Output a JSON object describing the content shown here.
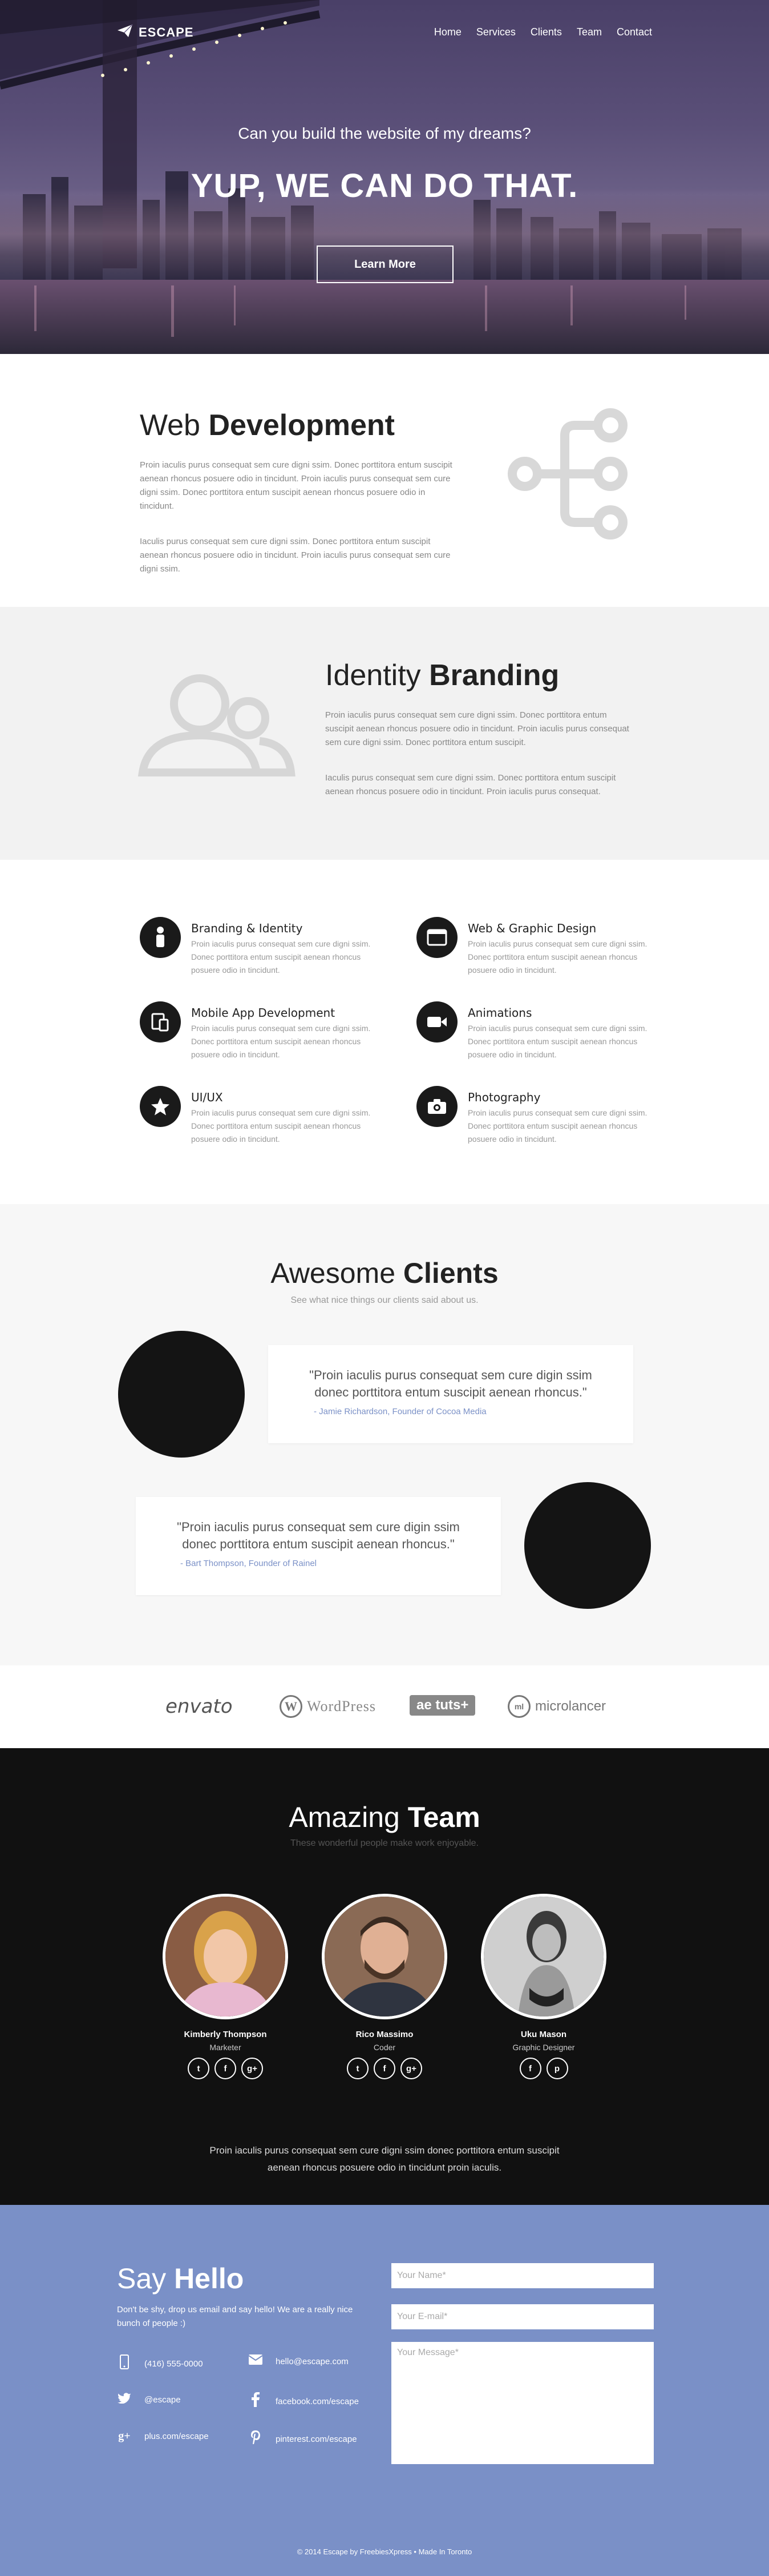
{
  "nav": {
    "brand": "ESCAPE",
    "links": [
      "Home",
      "Services",
      "Clients",
      "Team",
      "Contact"
    ]
  },
  "hero": {
    "subtitle": "Can you build the website of my dreams?",
    "title": "YUP, WE CAN DO THAT.",
    "button": "Learn More"
  },
  "web_dev": {
    "title_light": "Web",
    "title_bold": "Development",
    "p1": "Proin iaculis purus consequat sem cure digni ssim. Donec porttitora entum suscipit aenean rhoncus posuere odio in tincidunt. Proin iaculis purus consequat sem cure digni ssim. Donec porttitora entum suscipit aenean rhoncus posuere odio in tincidunt.",
    "p2": "Iaculis purus consequat sem cure digni ssim. Donec porttitora entum suscipit aenean rhoncus posuere odio in tincidunt. Proin iaculis purus consequat sem cure digni ssim."
  },
  "branding": {
    "title_light": "Identity",
    "title_bold": "Branding",
    "p1": "Proin iaculis purus consequat sem cure digni ssim. Donec porttitora entum suscipit aenean rhoncus posuere odio in tincidunt. Proin iaculis purus consequat sem cure digni ssim. Donec porttitora entum suscipit.",
    "p2": "Iaculis purus consequat sem cure digni ssim. Donec porttitora entum suscipit aenean rhoncus posuere odio in tincidunt. Proin iaculis purus consequat."
  },
  "services": [
    {
      "title": "Branding & Identity",
      "text": "Proin iaculis purus consequat sem cure digni ssim. Donec porttitora entum suscipit aenean rhoncus posuere odio in tincidunt.",
      "icon": "person-icon"
    },
    {
      "title": "Web & Graphic Design",
      "text": "Proin iaculis purus consequat sem cure digni ssim. Donec porttitora entum suscipit aenean rhoncus posuere odio in tincidunt.",
      "icon": "browser-icon"
    },
    {
      "title": "Mobile App Development",
      "text": "Proin iaculis purus consequat sem cure digni ssim. Donec porttitora entum suscipit aenean rhoncus posuere odio in tincidunt.",
      "icon": "devices-icon"
    },
    {
      "title": "Animations",
      "text": "Proin iaculis purus consequat sem cure digni ssim. Donec porttitora entum suscipit aenean rhoncus posuere odio in tincidunt.",
      "icon": "video-camera-icon"
    },
    {
      "title": "UI/UX",
      "text": "Proin iaculis purus consequat sem cure digni ssim. Donec porttitora entum suscipit aenean rhoncus posuere odio in tincidunt.",
      "icon": "star-icon"
    },
    {
      "title": "Photography",
      "text": "Proin iaculis purus consequat sem cure digni ssim. Donec porttitora entum suscipit aenean rhoncus posuere odio in tincidunt.",
      "icon": "camera-icon"
    }
  ],
  "clients": {
    "title_light": "Awesome",
    "title_bold": "Clients",
    "subtitle": "See what nice things our clients said about us.",
    "testimonials": [
      {
        "quote": "\"Proin iaculis purus consequat sem cure digin ssim donec porttitora entum suscipit aenean rhoncus.\"",
        "author": "- Jamie Richardson, Founder of Cocoa Media"
      },
      {
        "quote": "\"Proin iaculis purus consequat sem cure digin ssim donec porttitora entum suscipit aenean rhoncus.\"",
        "author": "- Bart Thompson, Founder of Rainel"
      }
    ]
  },
  "logos": [
    "envato",
    "WordPress",
    "ae tuts+",
    "microlancer"
  ],
  "team": {
    "title_light": "Amazing",
    "title_bold": "Team",
    "subtitle": "These wonderful people make work enjoyable.",
    "members": [
      {
        "name": "Kimberly Thompson",
        "role": "Marketer"
      },
      {
        "name": "Rico Massimo",
        "role": "Coder"
      },
      {
        "name": "Uku Mason",
        "role": "Graphic Designer"
      }
    ],
    "social_glyphs": [
      "t",
      "f",
      "g+",
      "p"
    ],
    "paragraph": "Proin iaculis purus consequat sem cure digni ssim donec porttitora entum suscipit aenean rhoncus posuere odio in tincidunt proin iaculis."
  },
  "contact": {
    "title_light": "Say",
    "title_bold": "Hello",
    "intro": "Don't be shy, drop us email and say hello! We are a really nice bunch of people :)",
    "phone": "(416) 555-0000",
    "email": "hello@escape.com",
    "twitter": "@escape",
    "facebook": "facebook.com/escape",
    "gplus": "plus.com/escape",
    "pinterest": "pinterest.com/escape",
    "name_placeholder": "Your Name*",
    "email_placeholder": "Your E-mail*",
    "message_placeholder": "Your Message*",
    "copyright": "© 2014 Escape by FreebiesXpress • Made In Toronto"
  },
  "colors": {
    "accent": "#7a90c7",
    "dark": "#111111",
    "link": "#7b91c7"
  }
}
